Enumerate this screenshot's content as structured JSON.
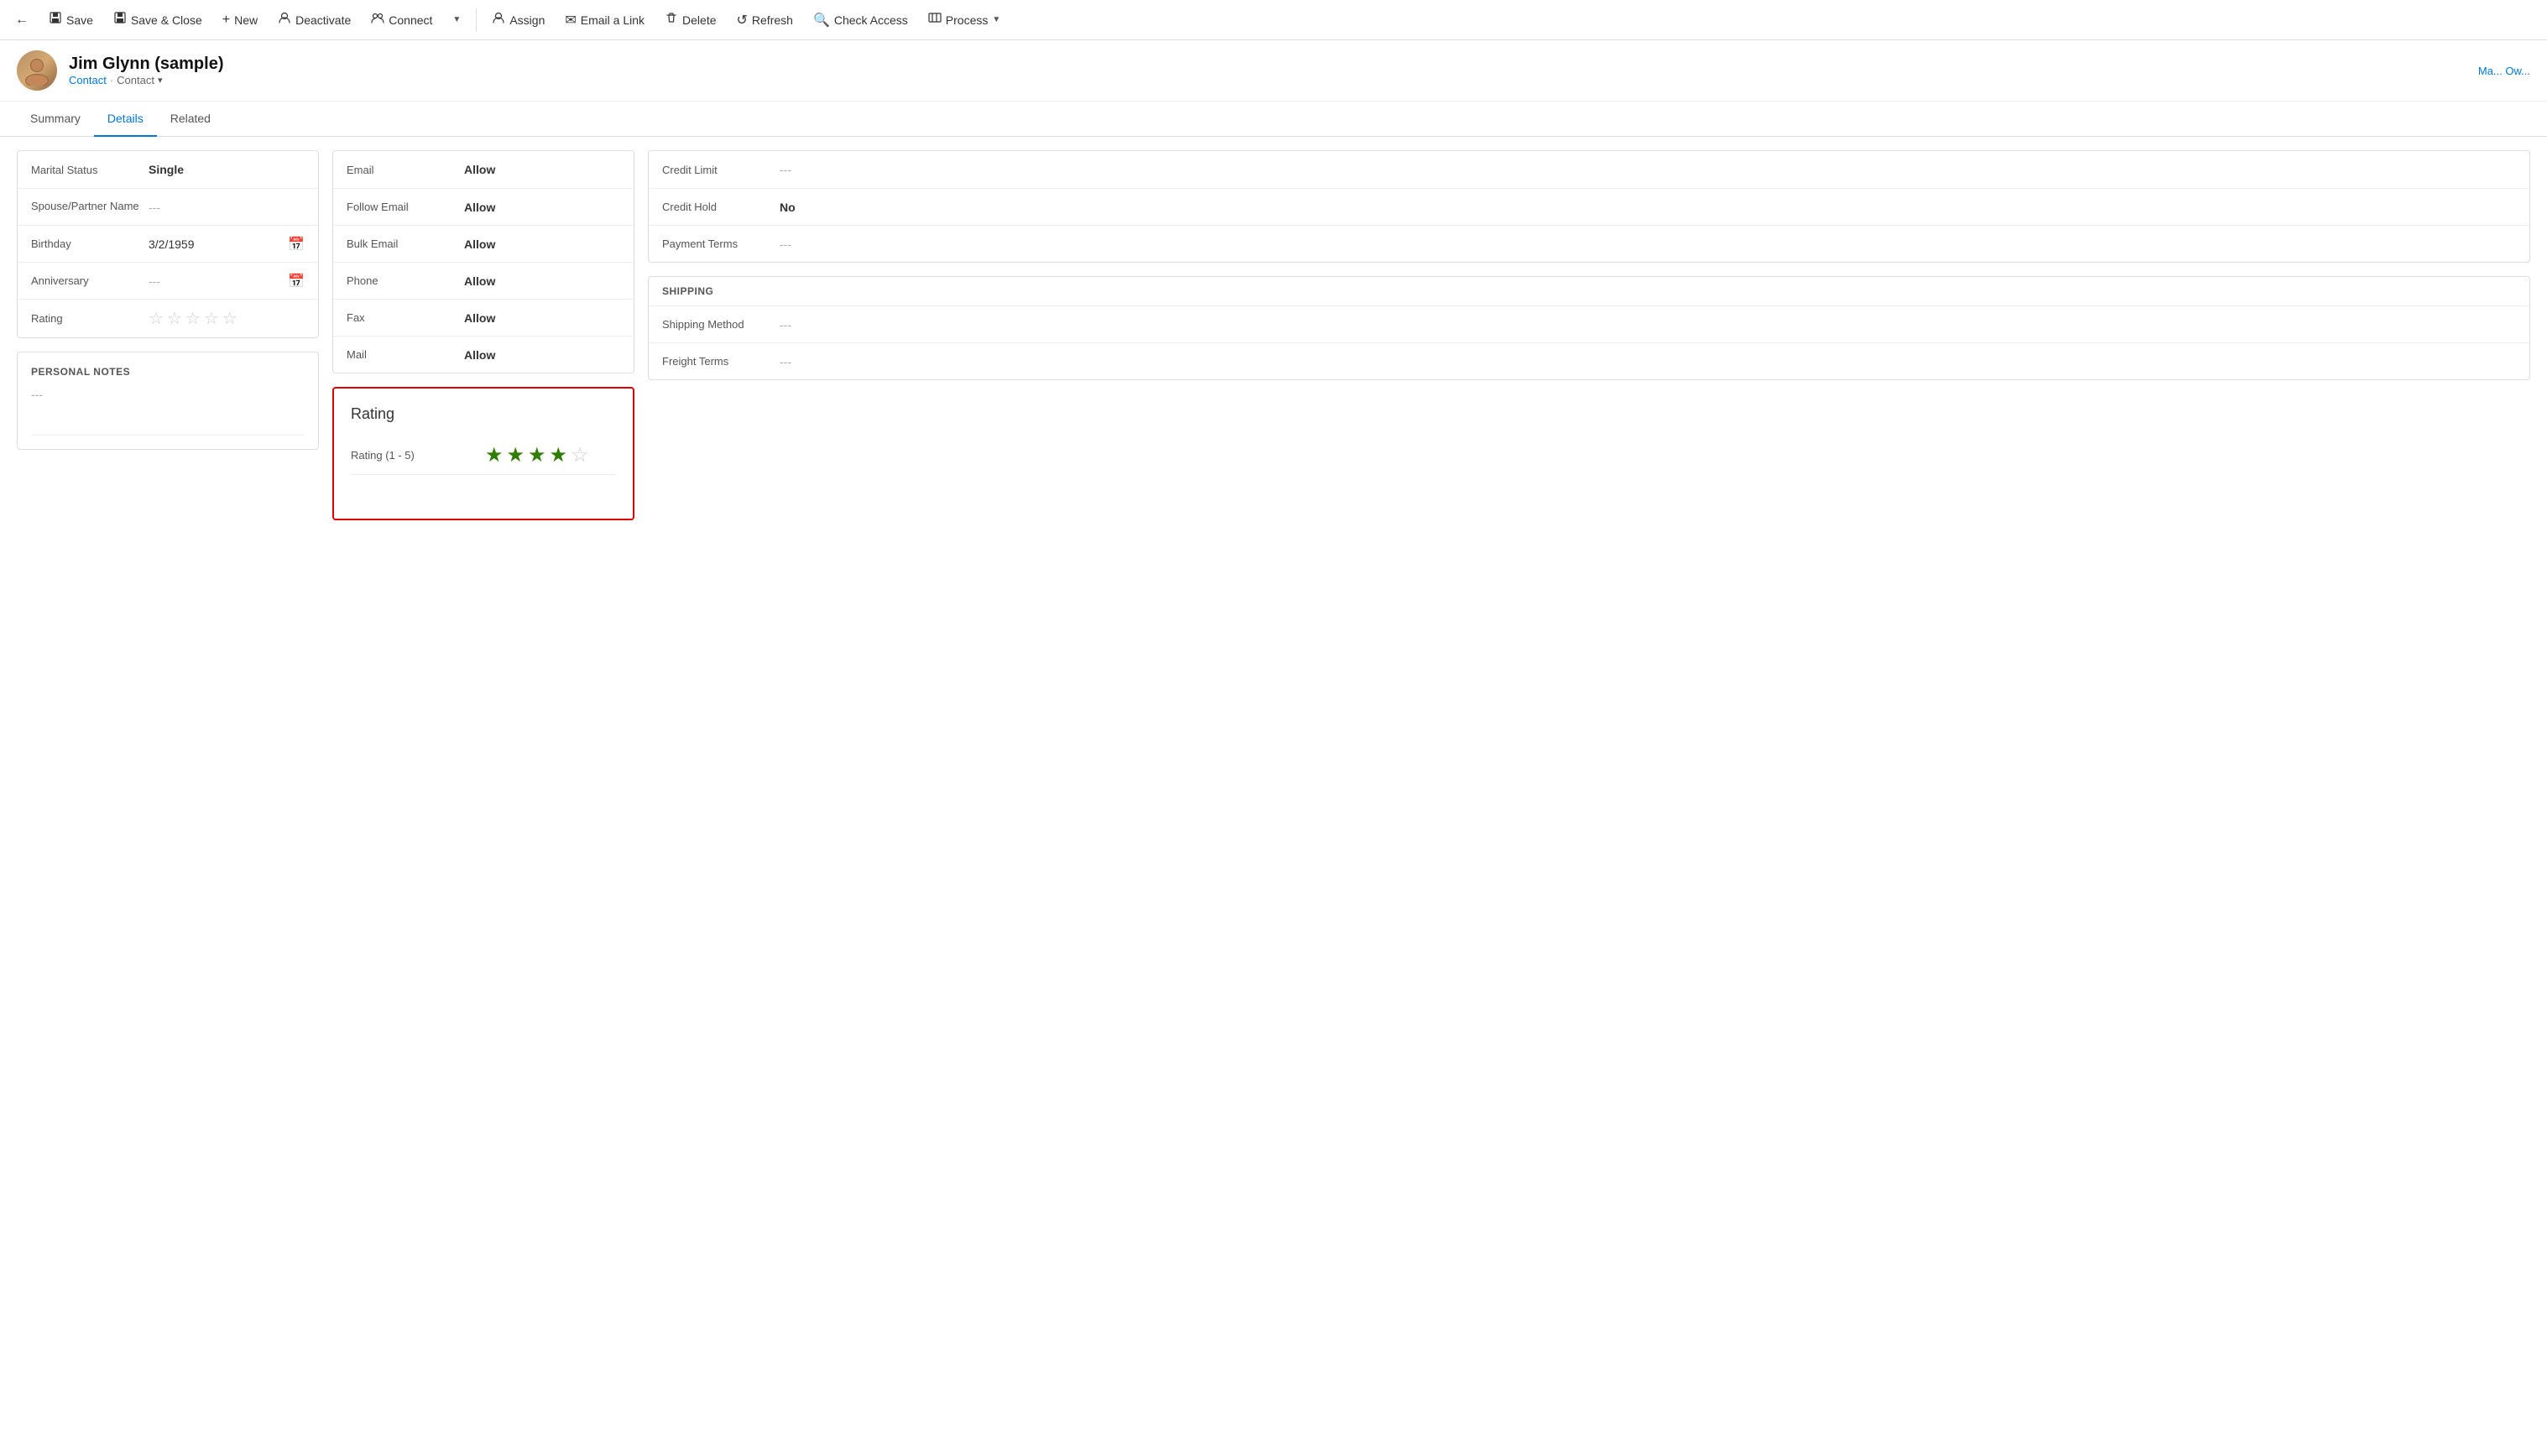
{
  "toolbar": {
    "back_icon": "←",
    "save_label": "Save",
    "save_icon": "💾",
    "save_close_label": "Save & Close",
    "save_close_icon": "💾",
    "new_label": "New",
    "new_icon": "+",
    "deactivate_label": "Deactivate",
    "deactivate_icon": "👤",
    "connect_label": "Connect",
    "connect_icon": "👥",
    "dropdown_arrow": "▼",
    "assign_label": "Assign",
    "assign_icon": "👤",
    "email_link_label": "Email a Link",
    "email_link_icon": "✉",
    "delete_label": "Delete",
    "delete_icon": "🗑",
    "refresh_label": "Refresh",
    "refresh_icon": "↺",
    "check_access_label": "Check Access",
    "check_access_icon": "🔍",
    "process_label": "Process",
    "process_icon": "📊"
  },
  "header": {
    "name": "Jim Glynn (sample)",
    "breadcrumb_type": "Contact",
    "breadcrumb_view": "Contact",
    "header_right": "Ma... Ow..."
  },
  "tabs": [
    {
      "label": "Summary",
      "active": false
    },
    {
      "label": "Details",
      "active": true
    },
    {
      "label": "Related",
      "active": false
    }
  ],
  "personal_info": {
    "marital_status_label": "Marital Status",
    "marital_status_value": "Single",
    "spouse_label": "Spouse/Partner Name",
    "spouse_value": "---",
    "birthday_label": "Birthday",
    "birthday_value": "3/2/1959",
    "anniversary_label": "Anniversary",
    "anniversary_value": "---",
    "rating_label": "Rating"
  },
  "personal_notes": {
    "title": "PERSONAL NOTES",
    "value": "---"
  },
  "communication": {
    "email_label": "Email",
    "email_value": "Allow",
    "follow_email_label": "Follow Email",
    "follow_email_value": "Allow",
    "bulk_email_label": "Bulk Email",
    "bulk_email_value": "Allow",
    "phone_label": "Phone",
    "phone_value": "Allow",
    "fax_label": "Fax",
    "fax_value": "Allow",
    "mail_label": "Mail",
    "mail_value": "Allow"
  },
  "rating_popup": {
    "title": "Rating",
    "rating_label": "Rating (1 - 5)",
    "filled_stars": 4,
    "total_stars": 5
  },
  "billing": {
    "credit_limit_label": "Credit Limit",
    "credit_limit_value": "---",
    "credit_hold_label": "Credit Hold",
    "credit_hold_value": "No",
    "payment_terms_label": "Payment Terms",
    "payment_terms_value": "---"
  },
  "shipping": {
    "section_title": "SHIPPING",
    "shipping_method_label": "Shipping Method",
    "shipping_method_value": "---",
    "freight_terms_label": "Freight Terms",
    "freight_terms_value": "---"
  }
}
